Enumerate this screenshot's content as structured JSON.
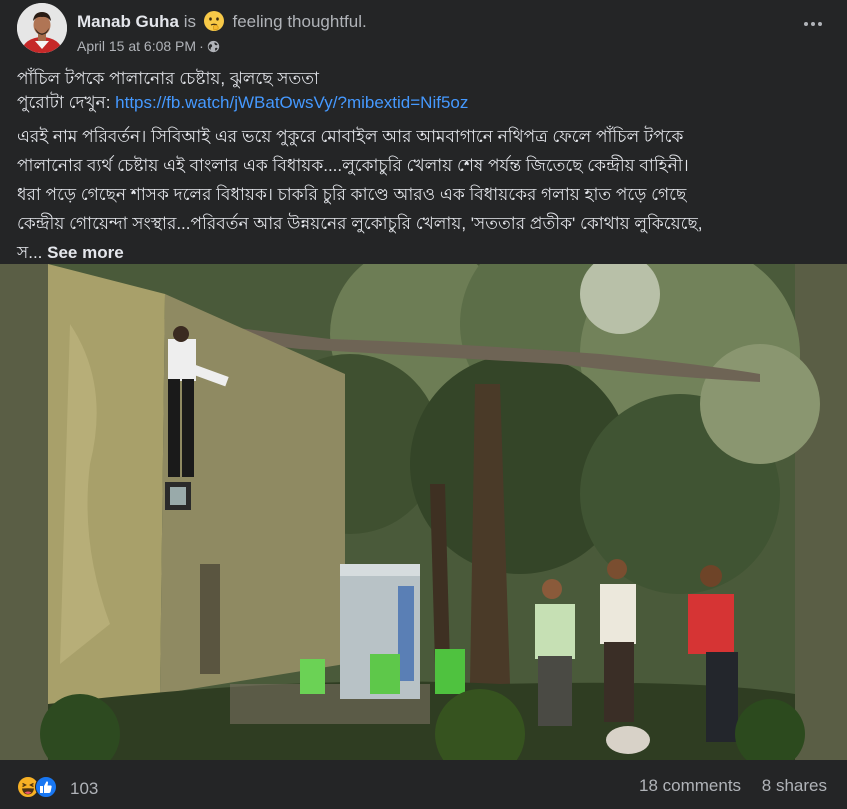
{
  "post": {
    "author": {
      "name": "Manab Guha",
      "feeling_prefix": "is",
      "feeling": "feeling thoughtful."
    },
    "timestamp": "April 15 at 6:08 PM",
    "separator": "·",
    "privacy_icon": "globe-icon",
    "caption": {
      "headline": "পাঁচিল টপকে পালানোর চেষ্টায়, ঝুলছে সততা",
      "link_prefix": "পুরোটা দেখুন: ",
      "link_text": "https://fb.watch/jWBatOwsVy/?mibextid=Nif5oz"
    },
    "body_lines": [
      "এরই নাম পরিবর্তন। সিবিআই এর ভয়ে পুকুরে মোবাইল আর আমবাগানে নথিপত্র ফেলে পাঁচিল টপকে",
      "পালানোর ব্যর্থ চেষ্টায় এই বাংলার এক বিধায়ক....লুকোচুরি খেলায় শেষ পর্যন্ত জিতেছে কেন্দ্রীয় বাহিনী।",
      "ধরা পড়ে গেছেন শাসক দলের বিধায়ক। চাকরি চুরি কাণ্ডে আরও এক বিধায়কের গলায় হাত পড়ে গেছে",
      "কেন্দ্রীয় গোয়েন্দা সংস্থার...পরিবর্তন আর উন্নয়নের লুকোচুরি খেলায়, 'সততার প্রতীক' কোথায় লুকিয়েছে,"
    ],
    "body_tail": "স...",
    "see_more": "See more",
    "reactions": {
      "icons": [
        "haha-icon",
        "like-icon"
      ],
      "count": "103"
    },
    "comments": "18 comments",
    "shares": "8 shares"
  },
  "colors": {
    "background": "#242526",
    "text": "#e4e6eb",
    "secondary_text": "#b0b3b8",
    "link": "#4599ff",
    "like_blue": "#1877f2",
    "haha_yellow": "#f7b125"
  }
}
